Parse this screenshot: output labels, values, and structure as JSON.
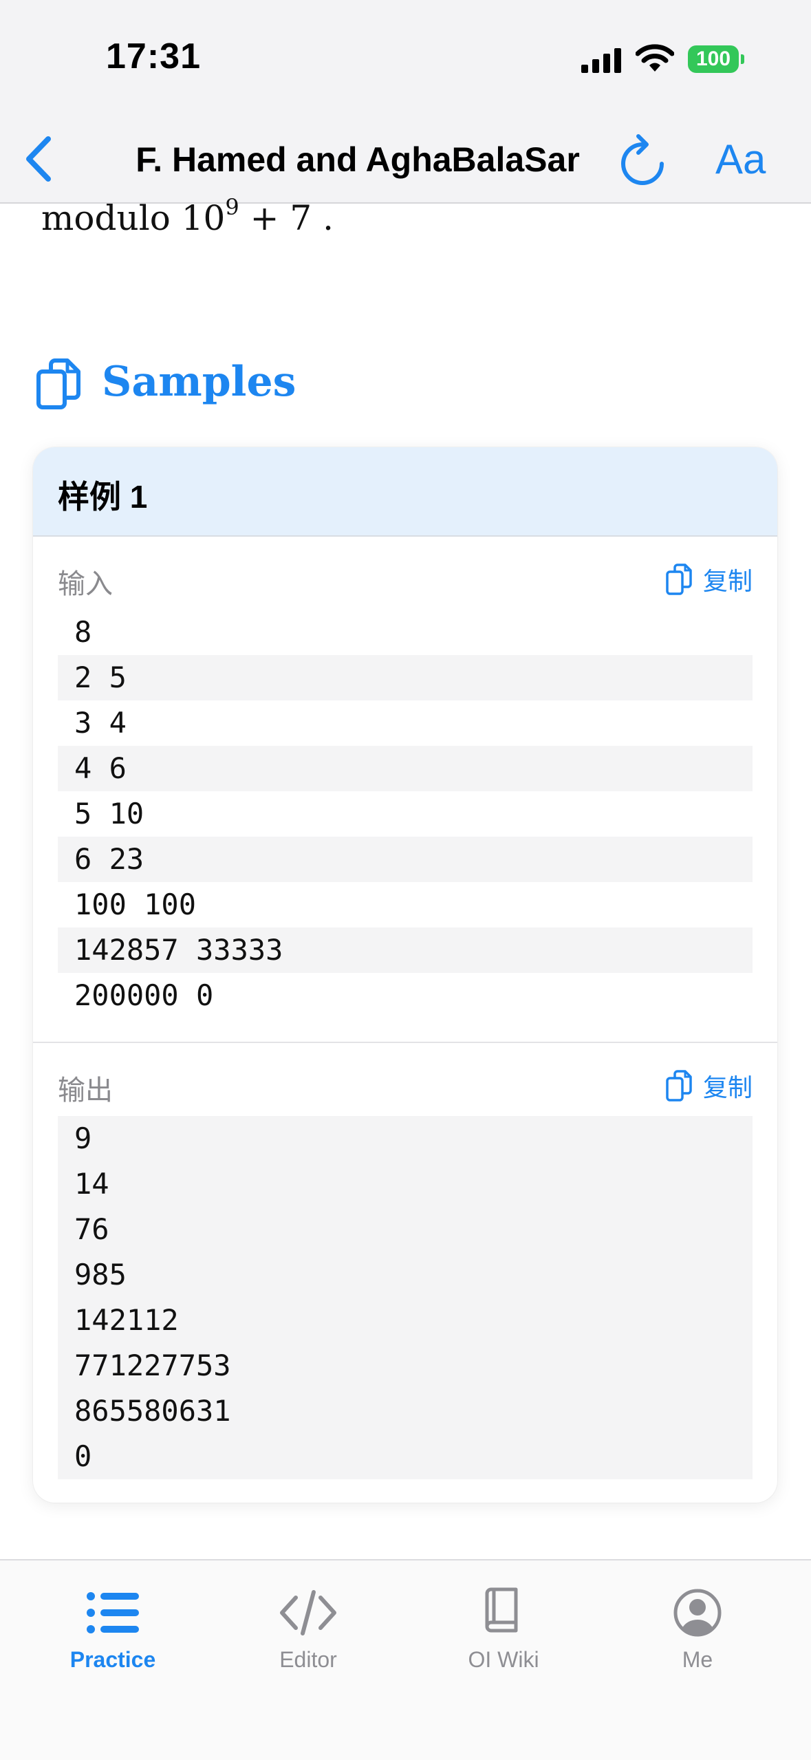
{
  "status_bar": {
    "time": "17:31",
    "battery": "100",
    "battery_color": "#33c759"
  },
  "nav": {
    "back_icon": "chevron-left-icon",
    "title": "F. Hamed and AghaBalaSar",
    "refresh_icon": "refresh-icon",
    "font_label": "Aa",
    "accent": "#1d86f0"
  },
  "content": {
    "modulo_text": "modulo 10",
    "modulo_exp": "9",
    "modulo_rest": " + 7 ."
  },
  "samples": {
    "heading": "Samples",
    "heading_icon": "copy-document-icon",
    "sample1": {
      "title": "样例 1",
      "input_label": "输入",
      "output_label": "输出",
      "copy_label": "复制",
      "input_lines": [
        "8",
        "2 5",
        "3 4",
        "4 6",
        "5 10",
        "6 23",
        "100 100",
        "142857 33333",
        "200000 0"
      ],
      "output_lines": [
        "9",
        "14",
        "76",
        "985",
        "142112",
        "771227753",
        "865580631",
        "0"
      ]
    }
  },
  "tabbar": {
    "tabs": [
      {
        "label": "Practice",
        "icon": "list-icon",
        "active": true
      },
      {
        "label": "Editor",
        "icon": "code-icon",
        "active": false
      },
      {
        "label": "OI Wiki",
        "icon": "book-icon",
        "active": false
      },
      {
        "label": "Me",
        "icon": "person-circle-icon",
        "active": false
      }
    ]
  }
}
